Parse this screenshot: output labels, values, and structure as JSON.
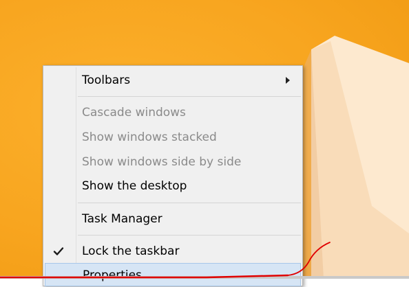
{
  "context_menu": {
    "items": [
      {
        "label": "Toolbars",
        "has_submenu": true
      },
      {
        "label": "Cascade windows",
        "disabled": true
      },
      {
        "label": "Show windows stacked",
        "disabled": true
      },
      {
        "label": "Show windows side by side",
        "disabled": true
      },
      {
        "label": "Show the desktop"
      },
      {
        "label": "Task Manager"
      },
      {
        "label": "Lock the taskbar",
        "checked": true
      },
      {
        "label": "Properties",
        "highlighted": true
      }
    ]
  },
  "colors": {
    "desktop_background": "#f8a51f",
    "menu_background": "#f0f0f0",
    "disabled_text": "#8a8a8a",
    "highlight": "#d6e5f5",
    "annotation_pen": "#e00000"
  },
  "icons": {
    "submenu": "chevron-right-icon",
    "check": "checkmark-icon"
  }
}
